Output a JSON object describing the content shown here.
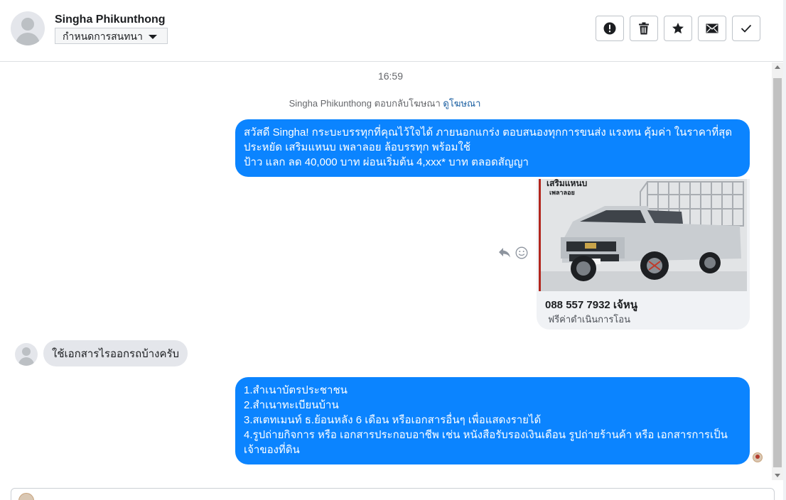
{
  "header": {
    "contact_name": "Singha Phikunthong",
    "label_select": "กำหนดการสนทนา",
    "toolbar": [
      {
        "name": "mark-spam-button",
        "icon": "exclamation-icon"
      },
      {
        "name": "delete-button",
        "icon": "trash-icon"
      },
      {
        "name": "star-button",
        "icon": "star-icon"
      },
      {
        "name": "mark-unread-button",
        "icon": "envelope-icon"
      },
      {
        "name": "mark-done-button",
        "icon": "check-icon"
      }
    ]
  },
  "chat": {
    "timestamp": "16:59",
    "reply_note": {
      "text": "Singha Phikunthong ตอบกลับโฆษณา",
      "link": "ดูโฆษณา"
    },
    "messages": [
      {
        "direction": "outgoing",
        "lines": [
          "สวัสดี Singha! กระบะบรรทุกที่คุณไว้ใจได้ ภายนอกแกร่ง ตอบสนองทุกการขนส่ง แรงทน คุ้มค่า ในราคาที่สุด",
          "ประหยัด เสริมแหนบ เพลาลอย ล้อบรรทุก พร้อมใช้",
          "ป้าว แลก ลด 40,000 บาท ผ่อนเริ่มต้น 4,xxx* บาท ตลอดสัญญา"
        ]
      },
      {
        "direction": "outgoing",
        "type": "ad_card",
        "image_text": [
          "เสริมแหนบ",
          "เพลาลอย"
        ],
        "title": "088 557 7932 เจ้หนู",
        "subtitle": "ฟรีค่าดำเนินการโอน"
      },
      {
        "direction": "incoming",
        "text": "ใช้เอกสารไรออกรถบ้างครับ"
      },
      {
        "direction": "outgoing",
        "lines": [
          "1.สำเนาบัตรประชาชน",
          "2.สำเนาทะเบียนบ้าน",
          "3.สเตทเมนท์ ธ.ย้อนหลัง 6 เดือน หรือเอกสารอื่นๆ เพื่อแสดงรายได้",
          "4.รูปถ่ายกิจการ หรือ เอกสารประกอบอาชีพ เช่น หนังสือรับรองเงินเดือน รูปถ่ายร้านค้า หรือ เอกสารการเป็น",
          "เจ้าของที่ดิน"
        ]
      }
    ]
  },
  "colors": {
    "outgoing_bubble": "#0b84ff",
    "incoming_bubble": "#e4e6eb",
    "link": "#1b5fa1"
  }
}
